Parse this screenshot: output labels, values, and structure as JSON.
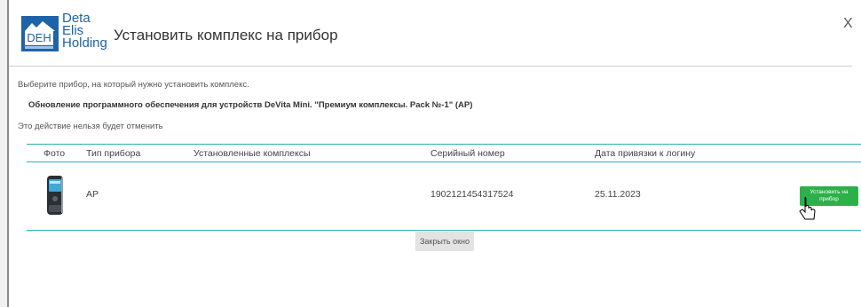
{
  "header": {
    "logo_lines": [
      "Deta",
      "Elis",
      "Holding"
    ],
    "logo_badge": "DEH",
    "title": "Установить комплекс на прибор",
    "close_label": "X"
  },
  "instruction": "Выберите прибор, на который нужно установить комплекс.",
  "update_title": "Обновление программного обеспечения для устройств DeVita Mini. \"Премиум комплексы. Pack №-1\" (AP)",
  "warning": "Это действие нельзя будет отменить",
  "table": {
    "columns": [
      "Фото",
      "Тип прибора",
      "Установленные комплексы",
      "Серийный номер",
      "Дата привязки к логину"
    ],
    "rows": [
      {
        "type": "AP",
        "installed": "",
        "serial": "1902121454317524",
        "date": "25.11.2023",
        "action": "Установить на прибор"
      }
    ]
  },
  "close_button": "Закрыть окно",
  "colors": {
    "accent_teal": "#2bb0b0",
    "install_green": "#2bb04a",
    "brand_blue": "#1e63a8"
  },
  "icons": {
    "device": "device-photo-icon",
    "cursor": "mouse-pointer-icon"
  }
}
